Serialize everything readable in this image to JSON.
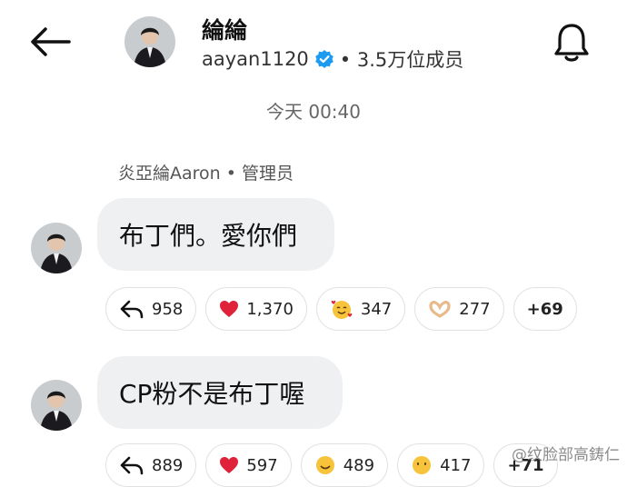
{
  "header": {
    "channel_name": "綸綸",
    "username": "aayan1120",
    "members": "• 3.5万位成员"
  },
  "timestamp": "今天 00:40",
  "sender": "炎亞綸Aaron • 管理员",
  "messages": [
    {
      "text": "布丁們。愛你們",
      "reactions": [
        {
          "icon": "reply-icon",
          "count": "958"
        },
        {
          "icon": "heart-icon",
          "count": "1,370"
        },
        {
          "icon": "smiling-face-hearts-icon",
          "count": "347"
        },
        {
          "icon": "heart-hands-icon",
          "count": "277"
        },
        {
          "icon": "",
          "count": "+69"
        }
      ]
    },
    {
      "text": "CP粉不是布丁喔",
      "reactions": [
        {
          "icon": "reply-icon",
          "count": "889"
        },
        {
          "icon": "heart-icon",
          "count": "597"
        },
        {
          "icon": "emoji-face-icon",
          "count": "489"
        },
        {
          "icon": "emoji-face-icon",
          "count": "417"
        },
        {
          "icon": "",
          "count": "+71"
        }
      ]
    }
  ],
  "watermark": "@纹脸部高鋳仁",
  "colors": {
    "verified": "#1d9bf0",
    "heart": "#e0213a",
    "bubble": "#eef0f2"
  }
}
